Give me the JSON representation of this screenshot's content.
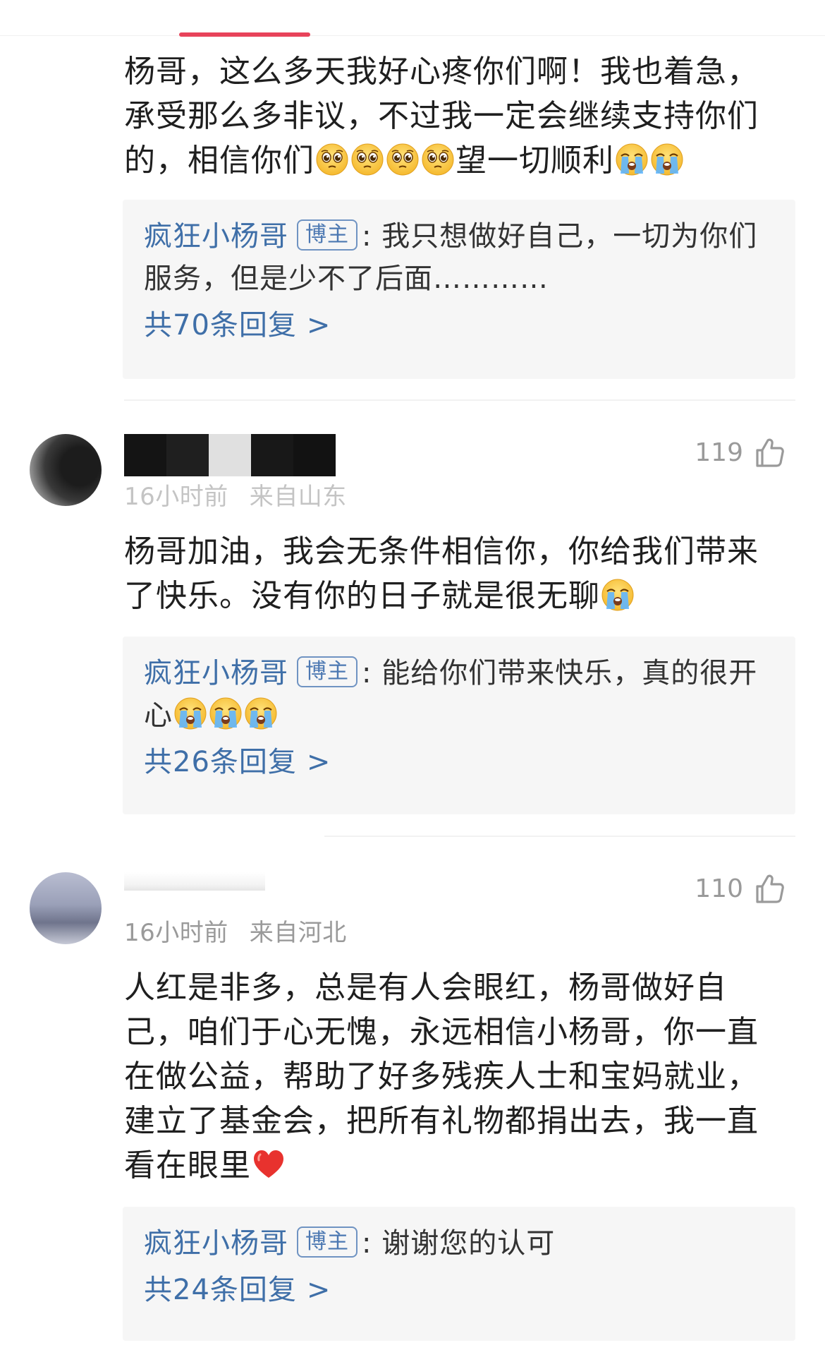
{
  "comment1": {
    "text": "杨哥，这么多天我好心疼你们啊！我也着急，承受那么多非议，不过我一定会继续支持你们的，相信你们",
    "text_after_emojis": "望一切顺利",
    "reply": {
      "author": "疯狂小杨哥",
      "badge": "博主",
      "text": "我只想做好自己，一切为你们服务，但是少不了后面…………",
      "count_label": "共70条回复",
      "chevron": ">"
    }
  },
  "comment2": {
    "time": "16小时前",
    "location": "来自山东",
    "likes": "119",
    "text": "杨哥加油，我会无条件相信你，你给我们带来了快乐。没有你的日子就是很无聊",
    "reply": {
      "author": "疯狂小杨哥",
      "badge": "博主",
      "text": "能给你们带来快乐，真的很开心",
      "count_label": "共26条回复",
      "chevron": ">"
    }
  },
  "comment3": {
    "time": "16小时前",
    "location": "来自河北",
    "likes": "110",
    "text": "人红是非多，总是有人会眼红，杨哥做好自己，咱们于心无愧，永远相信小杨哥，你一直在做公益，帮助了好多残疾人士和宝妈就业，建立了基金会，把所有礼物都捐出去，我一直看在眼里",
    "reply": {
      "author": "疯狂小杨哥",
      "badge": "博主",
      "text": "谢谢您的认可",
      "count_label": "共24条回复",
      "chevron": ">"
    }
  },
  "colors": {
    "accent_red": "#e8435a",
    "author_blue": "#3f6fa8",
    "reply_bg": "#f6f6f6",
    "meta_gray": "#9a9a9a"
  },
  "icons": {
    "like": "thumbs-up-outline-icon",
    "pleading": "pleading-face-emoji",
    "crying": "loudly-crying-face-emoji",
    "heart": "red-heart-emoji"
  }
}
